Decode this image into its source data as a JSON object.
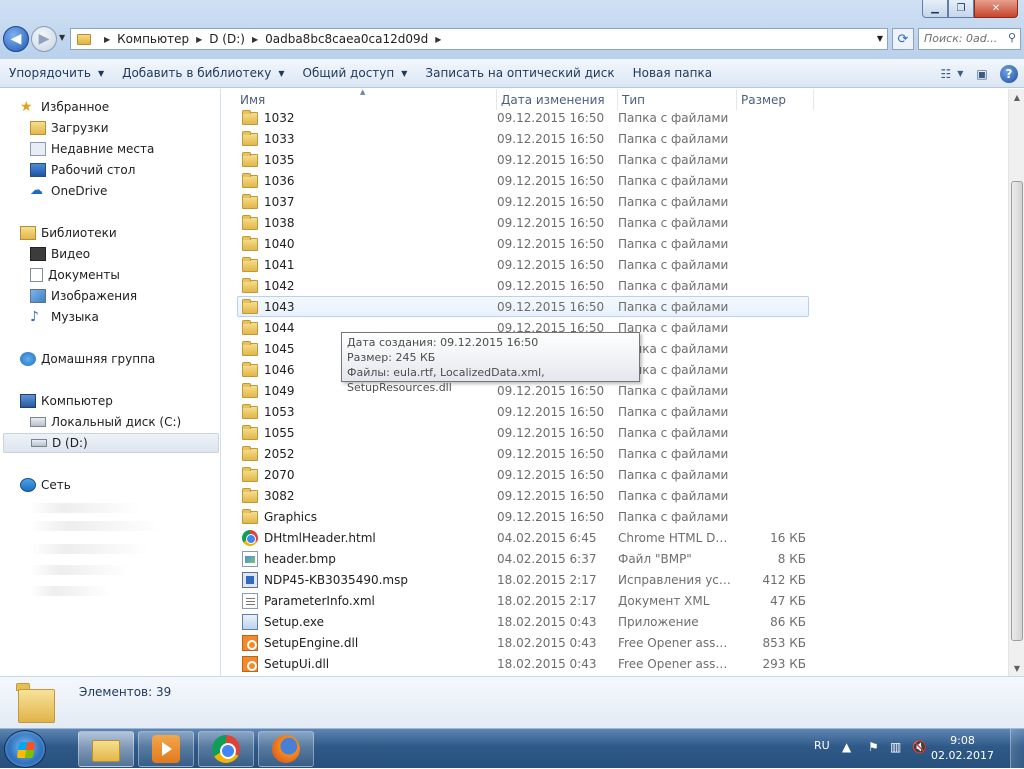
{
  "window": {
    "controls": {
      "minimize": "▁",
      "restore": "❐",
      "close": "✕"
    }
  },
  "address": {
    "crumbs": [
      "Компьютер",
      "D (D:)",
      "0adba8bc8caea0ca12d09d"
    ],
    "search_placeholder": "Поиск: 0ad..."
  },
  "toolbar": {
    "items": [
      "Упорядочить",
      "Добавить в библиотеку",
      "Общий доступ",
      "Записать на оптический диск",
      "Новая папка"
    ]
  },
  "nav": {
    "favorites": "Избранное",
    "downloads": "Загрузки",
    "recent": "Недавние места",
    "desktop": "Рабочий стол",
    "onedrive": "OneDrive",
    "libraries": "Библиотеки",
    "video": "Видео",
    "documents": "Документы",
    "pictures": "Изображения",
    "music": "Музыка",
    "homegroup": "Домашняя группа",
    "computer": "Компьютер",
    "local_c": "Локальный диск (C:)",
    "drive_d": "D (D:)",
    "network": "Сеть"
  },
  "columns": {
    "name": "Имя",
    "date": "Дата изменения",
    "type": "Тип",
    "size": "Размер"
  },
  "files": [
    {
      "name": "1032",
      "date": "09.12.2015 16:50",
      "type": "Папка с файлами",
      "size": "",
      "icon": "folder"
    },
    {
      "name": "1033",
      "date": "09.12.2015 16:50",
      "type": "Папка с файлами",
      "size": "",
      "icon": "folder"
    },
    {
      "name": "1035",
      "date": "09.12.2015 16:50",
      "type": "Папка с файлами",
      "size": "",
      "icon": "folder"
    },
    {
      "name": "1036",
      "date": "09.12.2015 16:50",
      "type": "Папка с файлами",
      "size": "",
      "icon": "folder"
    },
    {
      "name": "1037",
      "date": "09.12.2015 16:50",
      "type": "Папка с файлами",
      "size": "",
      "icon": "folder"
    },
    {
      "name": "1038",
      "date": "09.12.2015 16:50",
      "type": "Папка с файлами",
      "size": "",
      "icon": "folder"
    },
    {
      "name": "1040",
      "date": "09.12.2015 16:50",
      "type": "Папка с файлами",
      "size": "",
      "icon": "folder"
    },
    {
      "name": "1041",
      "date": "09.12.2015 16:50",
      "type": "Папка с файлами",
      "size": "",
      "icon": "folder"
    },
    {
      "name": "1042",
      "date": "09.12.2015 16:50",
      "type": "Папка с файлами",
      "size": "",
      "icon": "folder"
    },
    {
      "name": "1043",
      "date": "09.12.2015 16:50",
      "type": "Папка с файлами",
      "size": "",
      "icon": "folder"
    },
    {
      "name": "1044",
      "date": "09.12.2015 16:50",
      "type": "Папка с файлами",
      "size": "",
      "icon": "folder"
    },
    {
      "name": "1045",
      "date": "09.12.2015 16:50",
      "type": "Папка с файлами",
      "size": "",
      "icon": "folder"
    },
    {
      "name": "1046",
      "date": "09.12.2015 16:50",
      "type": "Папка с файлами",
      "size": "",
      "icon": "folder"
    },
    {
      "name": "1049",
      "date": "09.12.2015 16:50",
      "type": "Папка с файлами",
      "size": "",
      "icon": "folder"
    },
    {
      "name": "1053",
      "date": "09.12.2015 16:50",
      "type": "Папка с файлами",
      "size": "",
      "icon": "folder"
    },
    {
      "name": "1055",
      "date": "09.12.2015 16:50",
      "type": "Папка с файлами",
      "size": "",
      "icon": "folder"
    },
    {
      "name": "2052",
      "date": "09.12.2015 16:50",
      "type": "Папка с файлами",
      "size": "",
      "icon": "folder"
    },
    {
      "name": "2070",
      "date": "09.12.2015 16:50",
      "type": "Папка с файлами",
      "size": "",
      "icon": "folder"
    },
    {
      "name": "3082",
      "date": "09.12.2015 16:50",
      "type": "Папка с файлами",
      "size": "",
      "icon": "folder"
    },
    {
      "name": "Graphics",
      "date": "09.12.2015 16:50",
      "type": "Папка с файлами",
      "size": "",
      "icon": "folder"
    },
    {
      "name": "DHtmlHeader.html",
      "date": "04.02.2015 6:45",
      "type": "Chrome HTML Do...",
      "size": "16 КБ",
      "icon": "chrome"
    },
    {
      "name": "header.bmp",
      "date": "04.02.2015 6:37",
      "type": "Файл \"BMP\"",
      "size": "8 КБ",
      "icon": "bmp"
    },
    {
      "name": "NDP45-KB3035490.msp",
      "date": "18.02.2015 2:17",
      "type": "Исправления уст...",
      "size": "412 КБ",
      "icon": "msi"
    },
    {
      "name": "ParameterInfo.xml",
      "date": "18.02.2015 2:17",
      "type": "Документ XML",
      "size": "47 КБ",
      "icon": "xml"
    },
    {
      "name": "Setup.exe",
      "date": "18.02.2015 0:43",
      "type": "Приложение",
      "size": "86 КБ",
      "icon": "exe"
    },
    {
      "name": "SetupEngine.dll",
      "date": "18.02.2015 0:43",
      "type": "Free Opener assoc...",
      "size": "853 КБ",
      "icon": "dll"
    },
    {
      "name": "SetupUi.dll",
      "date": "18.02.2015 0:43",
      "type": "Free Opener assoc...",
      "size": "293 КБ",
      "icon": "dll"
    }
  ],
  "tooltip": {
    "created": "Дата создания: 09.12.2015 16:50",
    "size": "Размер: 245 КБ",
    "files": "Файлы: eula.rtf, LocalizedData.xml, SetupResources.dll"
  },
  "details": {
    "count": "Элементов: 39"
  },
  "taskbar": {
    "lang": "RU",
    "time": "9:08",
    "date": "02.02.2017"
  }
}
